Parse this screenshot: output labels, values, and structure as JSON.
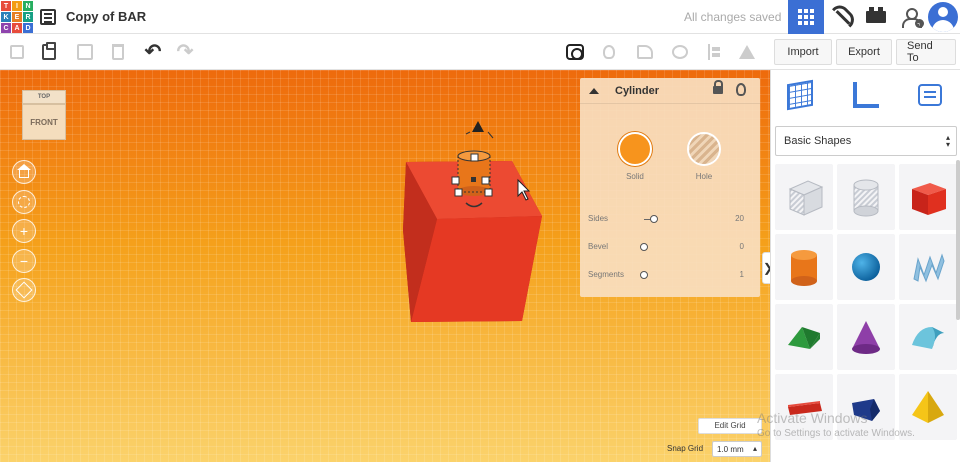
{
  "app": {
    "logo_letters": [
      "T",
      "I",
      "N",
      "K",
      "E",
      "R",
      "C",
      "A",
      "D"
    ],
    "logo_colors": [
      "#e74c3c",
      "#f39c12",
      "#27ae60",
      "#2980b9",
      "#e67e22",
      "#16a085",
      "#8e44ad",
      "#e74c3c",
      "#3b6fd4"
    ],
    "brand_color": "#3b6fd4"
  },
  "header": {
    "list_icon": "list-icon",
    "doc_title": "Copy of BAR",
    "save_status": "All changes saved",
    "view_buttons": [
      {
        "name": "3d-design-view",
        "icon": "grid-icon",
        "active": true
      },
      {
        "name": "blocks-view",
        "icon": "pickaxe-icon",
        "active": false
      },
      {
        "name": "bricks-view",
        "icon": "brick-icon",
        "active": false
      },
      {
        "name": "invite-users",
        "icon": "user-add-icon",
        "active": false
      },
      {
        "name": "profile",
        "icon": "avatar-icon",
        "active": false
      }
    ]
  },
  "toolbar": {
    "edit_tools": [
      {
        "name": "copy",
        "icon": "copy-icon",
        "enabled": false
      },
      {
        "name": "paste",
        "icon": "paste-icon",
        "enabled": true
      },
      {
        "name": "duplicate",
        "icon": "duplicate-icon",
        "enabled": false
      },
      {
        "name": "delete",
        "icon": "trash-icon",
        "enabled": false
      },
      {
        "name": "undo",
        "icon": "undo-icon",
        "enabled": true
      },
      {
        "name": "redo",
        "icon": "redo-icon",
        "enabled": false
      }
    ],
    "view_tools": [
      {
        "name": "notes-toggle",
        "icon": "eye-bubble-icon",
        "enabled": true
      },
      {
        "name": "show-all",
        "icon": "bulb-icon",
        "enabled": false
      },
      {
        "name": "group",
        "icon": "group-icon",
        "enabled": false
      },
      {
        "name": "ungroup",
        "icon": "ungroup-icon",
        "enabled": false
      },
      {
        "name": "align",
        "icon": "align-icon",
        "enabled": false
      },
      {
        "name": "mirror",
        "icon": "mirror-icon",
        "enabled": false
      }
    ],
    "import_label": "Import",
    "export_label": "Export",
    "send_label": "Send To"
  },
  "viewcube": {
    "top": "TOP",
    "front": "FRONT"
  },
  "nav_controls": [
    {
      "name": "home-view",
      "icon": "home-icon"
    },
    {
      "name": "fit-view",
      "icon": "fit-icon"
    },
    {
      "name": "zoom-in",
      "icon": "plus-icon",
      "glyph": "+"
    },
    {
      "name": "zoom-out",
      "icon": "minus-icon",
      "glyph": "−"
    },
    {
      "name": "perspective",
      "icon": "cube-icon"
    }
  ],
  "inspector": {
    "title": "Cylinder",
    "solid_label": "Solid",
    "hole_label": "Hole",
    "solid_color": "#f7941d",
    "properties": [
      {
        "label": "Sides",
        "value": "20",
        "knob_fraction": 0.6
      },
      {
        "label": "Bevel",
        "value": "0",
        "knob_fraction": 0.0
      },
      {
        "label": "Segments",
        "value": "1",
        "knob_fraction": 0.0
      }
    ]
  },
  "scene": {
    "box_color": "#e53923",
    "cylinder_color": "#e8761a"
  },
  "right_panel": {
    "tabs": [
      {
        "name": "workplane",
        "icon": "workplane-icon"
      },
      {
        "name": "ruler",
        "icon": "ruler-icon"
      },
      {
        "name": "notes",
        "icon": "notes-icon"
      }
    ],
    "library_label": "Basic Shapes",
    "shapes": [
      {
        "name": "box-hole",
        "icon": "box-hole-icon"
      },
      {
        "name": "cylinder-hole",
        "icon": "cylinder-hole-icon"
      },
      {
        "name": "box",
        "icon": "box-icon"
      },
      {
        "name": "cylinder",
        "icon": "cylinder-icon"
      },
      {
        "name": "sphere",
        "icon": "sphere-icon"
      },
      {
        "name": "scribble",
        "icon": "scribble-icon"
      },
      {
        "name": "roof",
        "icon": "roof-icon"
      },
      {
        "name": "cone",
        "icon": "cone-icon"
      },
      {
        "name": "round-roof",
        "icon": "round-roof-icon"
      },
      {
        "name": "text",
        "icon": "text-icon"
      },
      {
        "name": "shape-generator",
        "icon": "shape-icon"
      },
      {
        "name": "pyramid",
        "icon": "pyramid-icon"
      }
    ]
  },
  "grid_controls": {
    "edit_grid_label": "Edit Grid",
    "snap_grid_label": "Snap Grid",
    "snap_value": "1.0 mm"
  },
  "watermark": {
    "title": "Activate Windows",
    "subtitle": "Go to Settings to activate Windows."
  }
}
